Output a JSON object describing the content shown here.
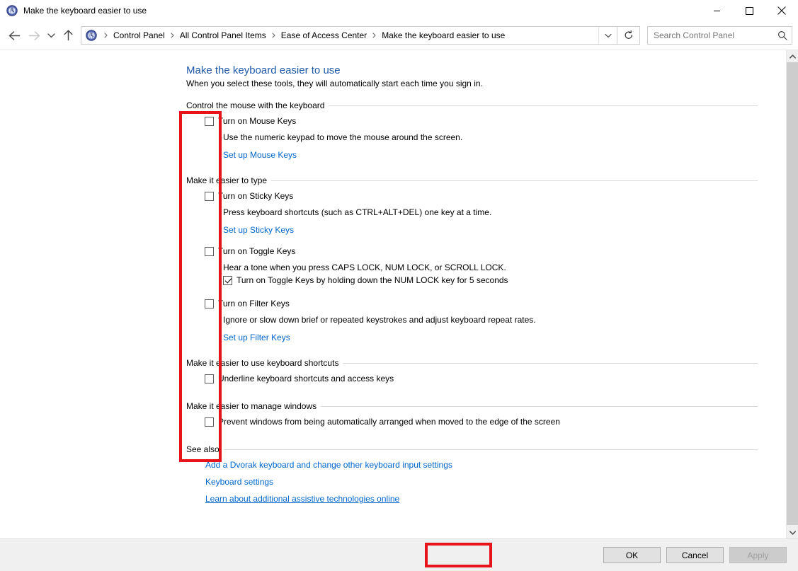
{
  "window": {
    "title": "Make the keyboard easier to use",
    "icon": "ease-of-access-icon",
    "minimize_label": "Minimize",
    "maximize_label": "Maximize",
    "close_label": "Close"
  },
  "nav": {
    "back_label": "Back",
    "forward_label": "Forward",
    "recent_label": "Recent locations",
    "up_label": "Up",
    "refresh_label": "Refresh",
    "dropdown_label": "Previous locations"
  },
  "breadcrumb": {
    "items": [
      "Control Panel",
      "All Control Panel Items",
      "Ease of Access Center",
      "Make the keyboard easier to use"
    ]
  },
  "search": {
    "placeholder": "Search Control Panel",
    "value": "",
    "icon": "search-icon"
  },
  "page": {
    "title": "Make the keyboard easier to use",
    "subtitle": "When you select these tools, they will automatically start each time you sign in."
  },
  "sections": [
    {
      "heading": "Control the mouse with the keyboard",
      "checkbox": {
        "label": "Turn on Mouse Keys",
        "checked": false
      },
      "description": "Use the numeric keypad to move the mouse around the screen.",
      "link": "Set up Mouse Keys"
    },
    {
      "heading": "Make it easier to type",
      "checkbox": {
        "label": "Turn on Sticky Keys",
        "checked": false
      },
      "description": "Press keyboard shortcuts (such as CTRL+ALT+DEL) one key at a time.",
      "link": "Set up Sticky Keys"
    },
    {
      "heading": "",
      "checkbox": {
        "label": "Turn on Toggle Keys",
        "checked": false
      },
      "description": "Hear a tone when you press CAPS LOCK, NUM LOCK, or SCROLL LOCK.",
      "sub_checkbox": {
        "label": "Turn on Toggle Keys by holding down the NUM LOCK key for 5 seconds",
        "checked": true
      }
    },
    {
      "heading": "",
      "checkbox": {
        "label": "Turn on Filter Keys",
        "checked": false
      },
      "description": "Ignore or slow down brief or repeated keystrokes and adjust keyboard repeat rates.",
      "link": "Set up Filter Keys"
    },
    {
      "heading": "Make it easier to use keyboard shortcuts",
      "checkbox": {
        "label": "Underline keyboard shortcuts and access keys",
        "checked": false
      }
    },
    {
      "heading": "Make it easier to manage windows",
      "checkbox": {
        "label": "Prevent windows from being automatically arranged when moved to the edge of the screen",
        "checked": false
      }
    }
  ],
  "see_also": {
    "heading": "See also",
    "links": [
      {
        "label": "Add a Dvorak keyboard and change other keyboard input settings",
        "underlined": false
      },
      {
        "label": "Keyboard settings",
        "underlined": false
      },
      {
        "label": "Learn about additional assistive technologies online",
        "underlined": true
      }
    ]
  },
  "footer": {
    "ok": "OK",
    "cancel": "Cancel",
    "apply": "Apply",
    "apply_disabled": true
  },
  "scrollbar": {
    "up_arrow": "scroll-up-icon",
    "down_arrow": "scroll-down-icon"
  },
  "annotations": {
    "accent_color": "#e8131a",
    "boxes": [
      "checkbox-column",
      "ok-button"
    ]
  }
}
